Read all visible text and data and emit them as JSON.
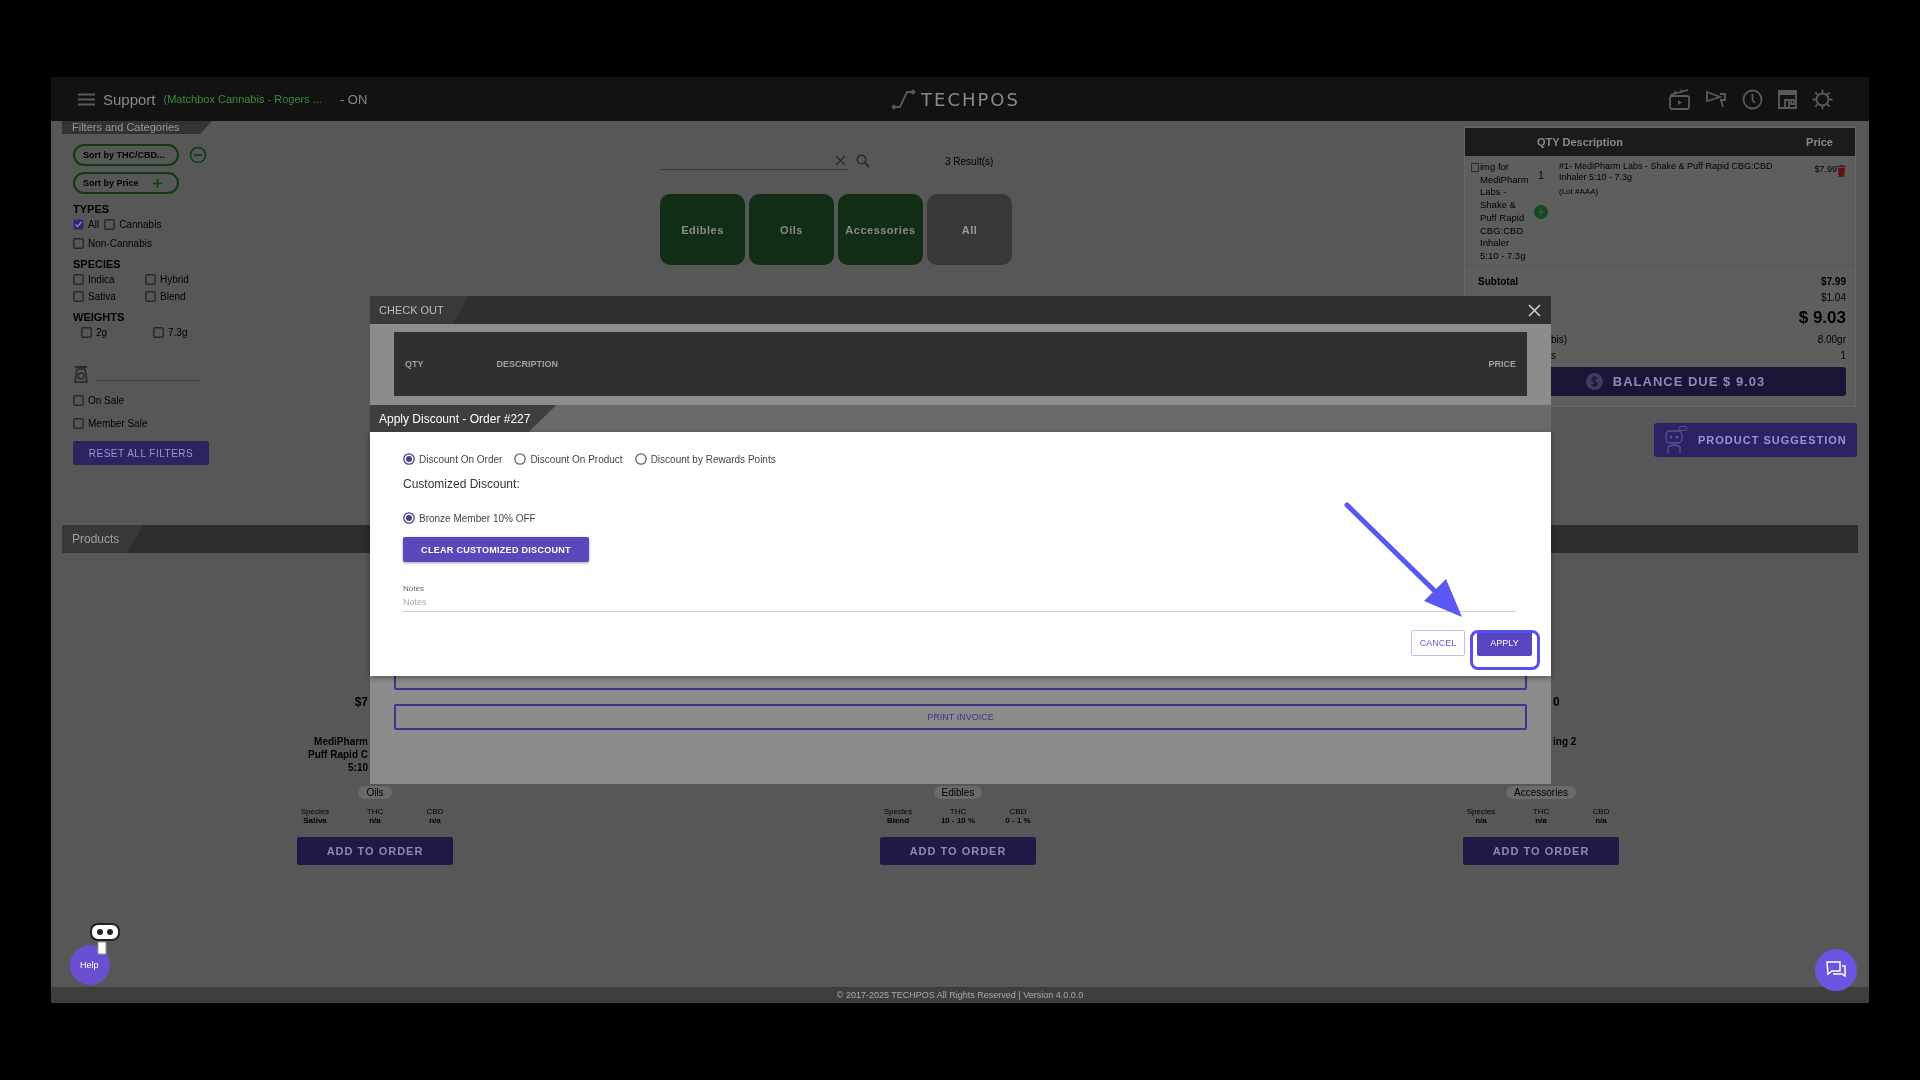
{
  "top_bar": {
    "menu_title": "Support",
    "store": "(Matchbox Cannabis - Rogers ...",
    "status": "- ON",
    "logo_text": "TECHPOS"
  },
  "filters": {
    "title": "Filters and Categories",
    "sorts": [
      {
        "label": "Sort by THC/CBD...",
        "kind": "remove"
      },
      {
        "label": "Sort by Price",
        "kind": "add"
      }
    ],
    "groups": [
      {
        "title": "TYPES",
        "kind": "flow",
        "options": [
          {
            "label": "All",
            "checked": true
          },
          {
            "label": "Cannabis",
            "checked": false
          },
          {
            "label": "Non-Cannabis",
            "checked": false
          }
        ]
      },
      {
        "title": "SPECIES",
        "kind": "grid",
        "options": [
          {
            "label": "Indica",
            "checked": false
          },
          {
            "label": "Hybrid",
            "checked": false
          },
          {
            "label": "Sativa",
            "checked": false
          },
          {
            "label": "Blend",
            "checked": false
          }
        ]
      },
      {
        "title": "WEIGHTS",
        "kind": "indented",
        "options": [
          {
            "label": "2g",
            "checked": false
          },
          {
            "label": "7.3g",
            "checked": false
          }
        ]
      }
    ],
    "toggles": [
      {
        "label": "On Sale",
        "checked": false
      },
      {
        "label": "Member Sale",
        "checked": false
      }
    ],
    "reset_button": "RESET ALL FILTERS"
  },
  "search": {
    "results": "3 Result(s)"
  },
  "categories": [
    {
      "label": "Edibles",
      "selected": false
    },
    {
      "label": "Oils",
      "selected": false
    },
    {
      "label": "Accessories",
      "selected": false
    },
    {
      "label": "All",
      "selected": true
    }
  ],
  "cart": {
    "columns": [
      "QTY Description",
      "Price"
    ],
    "item": {
      "image_alt": "img for MediPharm Labs - Shake & Puff Rapid CBG:CBD Inhaler 5:10 - 7.3g",
      "qty": "1",
      "description": "#1- MediPharm Labs - Shake & Puff Rapid CBG:CBD Inhaler 5:10 - 7.3g",
      "lot": "(Lot #AAA)",
      "price": "$7.99"
    },
    "summary": [
      {
        "kind": "subtotal",
        "label": "Subtotal",
        "value": "$7.99"
      },
      {
        "kind": "plain",
        "value": "$1.04"
      },
      {
        "kind": "total",
        "value": "$ 9.03"
      },
      {
        "kind": "partial",
        "label": "bis)",
        "value": "8.00gr"
      },
      {
        "kind": "partial",
        "label": "s",
        "value": "1"
      }
    ],
    "balance_button": "BALANCE DUE $ 9.03"
  },
  "suggestion_button": "PRODUCT SUGGESTION",
  "products": {
    "title": "Products",
    "items": [
      {
        "price": "$7",
        "name_lines": [
          "MediPharm",
          "Puff Rapid C",
          "5:10"
        ],
        "category": "Oils",
        "specs": [
          {
            "label": "Species",
            "value": "Sativa"
          },
          {
            "label": "THC",
            "value": "n/a"
          },
          {
            "label": "CBD",
            "value": "n/a"
          }
        ],
        "button": "ADD TO ORDER"
      },
      {
        "category": "Edibles",
        "specs": [
          {
            "label": "Species",
            "value": "Blend"
          },
          {
            "label": "THC",
            "value": "10 - 10 %"
          },
          {
            "label": "CBD",
            "value": "0 - 1 %"
          }
        ],
        "button": "ADD TO ORDER"
      },
      {
        "price": "0",
        "name_lines": [
          "ing 2"
        ],
        "category": "Accessories",
        "specs": [
          {
            "label": "Species",
            "value": "n/a"
          },
          {
            "label": "THC",
            "value": "n/a"
          },
          {
            "label": "CBD",
            "value": "n/a"
          }
        ],
        "button": "ADD TO ORDER"
      }
    ]
  },
  "checkout": {
    "title": "CHECK OUT",
    "columns": [
      "QTY",
      "DESCRIPTION",
      "PRICE"
    ],
    "print_button": "PRINT INVOICE"
  },
  "discount": {
    "title": "Apply Discount - Order #227",
    "types": [
      {
        "label": "Discount On Order",
        "selected": true
      },
      {
        "label": "Discount On Product",
        "selected": false
      },
      {
        "label": "Discount by Rewards Points",
        "selected": false
      }
    ],
    "customized_label": "Customized Discount:",
    "customized_options": [
      {
        "label": "Bronze Member 10% OFF",
        "selected": true
      }
    ],
    "clear_button": "CLEAR CUSTOMIZED DISCOUNT",
    "notes": {
      "label": "Notes",
      "placeholder": "Notes"
    },
    "cancel_button": "CANCEL",
    "apply_button": "APPLY"
  },
  "help_label": "Help",
  "footer": "© 2017-2025 TECHPOS All Rights Reserved | Version 4.0.0.0"
}
